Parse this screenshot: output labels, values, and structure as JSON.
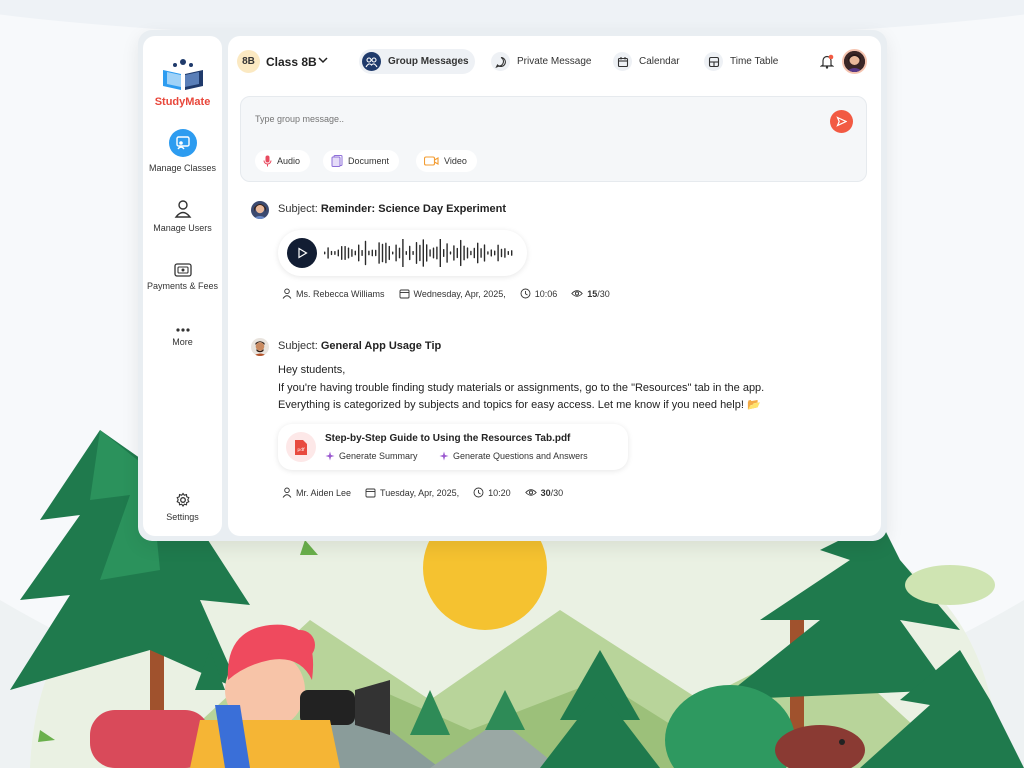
{
  "app": {
    "name": "StudyMate",
    "accent": "#e8473b",
    "primary_dark": "#1f3a6b",
    "send_color": "#f25a43"
  },
  "sidebar": {
    "items": [
      {
        "label": "Manage Classes",
        "icon": "manage-classes-icon",
        "active": true
      },
      {
        "label": "Manage Users",
        "icon": "user-icon",
        "active": false
      },
      {
        "label": "Payments & Fees",
        "icon": "payments-icon",
        "active": false
      },
      {
        "label": "More",
        "icon": "more-dots-icon",
        "active": false
      }
    ],
    "settings_label": "Settings"
  },
  "header": {
    "class_badge": "8B",
    "class_name": "Class 8B",
    "tabs": [
      {
        "label": "Group Messages",
        "icon": "group-icon",
        "active": true
      },
      {
        "label": "Private Message",
        "icon": "chat-bubble-icon",
        "active": false
      },
      {
        "label": "Calendar",
        "icon": "calendar-icon",
        "active": false
      },
      {
        "label": "Time Table",
        "icon": "timetable-icon",
        "active": false
      }
    ]
  },
  "composer": {
    "placeholder": "Type group message..",
    "attachments": [
      {
        "label": "Audio",
        "icon": "microphone-icon",
        "color": "#e84a5f"
      },
      {
        "label": "Document",
        "icon": "document-icon",
        "color": "#8e6fd8"
      },
      {
        "label": "Video",
        "icon": "video-icon",
        "color": "#f39c32"
      }
    ]
  },
  "messages": [
    {
      "subject_prefix": "Subject: ",
      "subject": "Reminder: Science Day Experiment",
      "type": "audio",
      "author": "Ms. Rebecca Williams",
      "date": "Wednesday, Apr, 2025,",
      "time": "10:06",
      "views_seen": "15",
      "views_total": "/30"
    },
    {
      "subject_prefix": "Subject: ",
      "subject": "General App Usage Tip",
      "type": "text",
      "body_lines": [
        "Hey students,",
        "If you're having trouble finding study materials or assignments, go to the \"Resources\" tab in the app.",
        "Everything is categorized by subjects and topics for easy access. Let me know if you need help! 📂"
      ],
      "attachment": {
        "file_name": "Step-by-Step Guide to Using the Resources Tab.pdf",
        "file_type": "pdf",
        "actions": [
          "Generate Summary",
          "Generate Questions and Answers"
        ]
      },
      "author": "Mr. Aiden Lee",
      "date": "Tuesday, Apr, 2025,",
      "time": "10:20",
      "views_seen": "30",
      "views_total": "/30"
    }
  ]
}
